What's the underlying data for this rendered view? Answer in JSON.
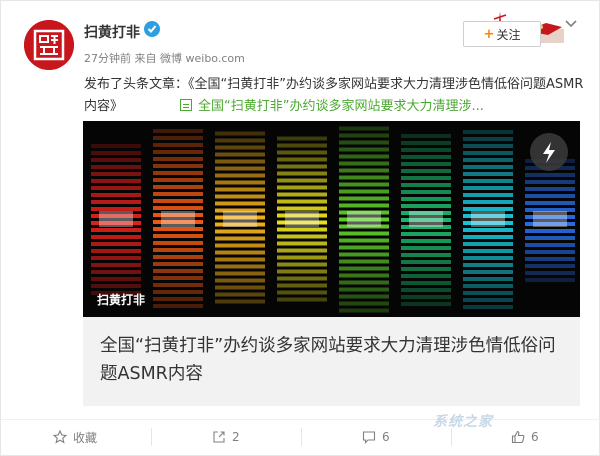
{
  "user": {
    "name": "扫黄打非",
    "verified_icon": "verified-badge-icon"
  },
  "meta": {
    "time": "27分钟前",
    "source_prefix": "来自",
    "source": "微博 weibo.com"
  },
  "header": {
    "follow_label": "关注",
    "follow_icon": "+"
  },
  "post": {
    "text": "发布了头条文章：《全国“扫黄打非”办约谈多家网站要求大力清理涉色情低俗问题ASMR内容》",
    "link_text": "全国“扫黄打非”办约谈多家网站要求大力清理涉..."
  },
  "article": {
    "image_label": "扫黄打非",
    "title": "全国“扫黄打非”办约谈多家网站要求大力清理涉色情低俗问题ASMR内容"
  },
  "actions": {
    "favorite_label": "收藏",
    "repost_count": "2",
    "comment_count": "6",
    "like_count": "6"
  },
  "watermark": "系统之家",
  "colors": {
    "brand_red": "#c8161d",
    "link_green": "#4aa82f",
    "follow_orange": "#ff8200",
    "muted": "#808080"
  }
}
